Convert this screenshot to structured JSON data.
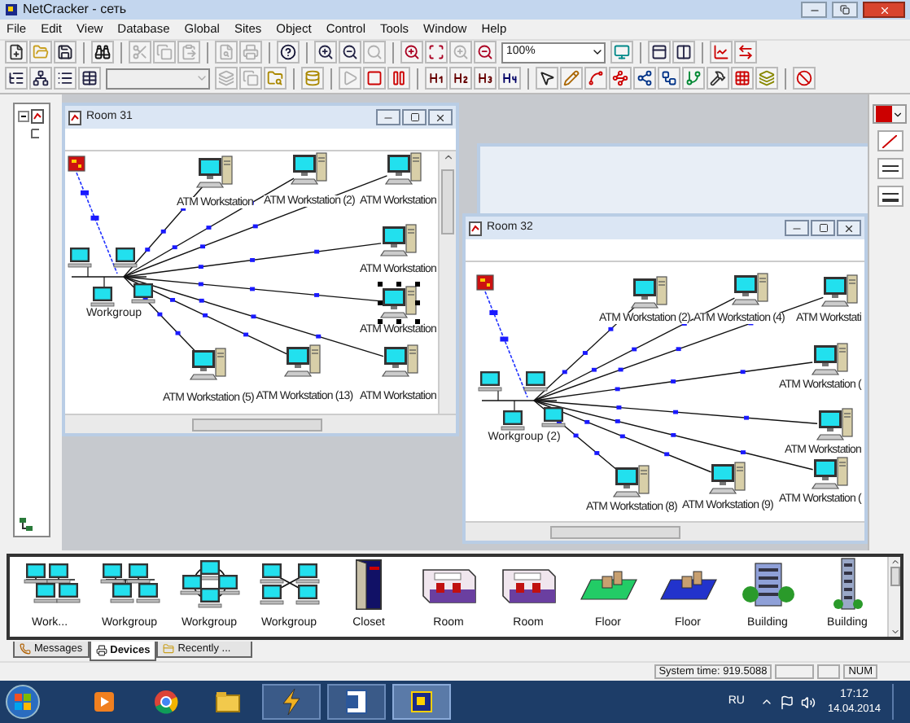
{
  "window": {
    "title": "NetCracker - сеть"
  },
  "menu": [
    "File",
    "Edit",
    "View",
    "Database",
    "Global",
    "Sites",
    "Object",
    "Control",
    "Tools",
    "Window",
    "Help"
  ],
  "toolbar_1": [
    {
      "kind": "button",
      "disabled": false
    },
    {
      "kind": "button",
      "disabled": false
    },
    {
      "kind": "button",
      "disabled": false
    },
    {
      "kind": "separator"
    },
    {
      "kind": "button",
      "disabled": false
    },
    {
      "kind": "separator"
    },
    {
      "kind": "button",
      "disabled": true
    },
    {
      "kind": "button",
      "disabled": true
    },
    {
      "kind": "button",
      "disabled": true
    },
    {
      "kind": "separator"
    },
    {
      "kind": "button",
      "disabled": true
    },
    {
      "kind": "button",
      "disabled": true
    },
    {
      "kind": "separator"
    },
    {
      "kind": "button",
      "disabled": false
    },
    {
      "kind": "separator"
    },
    {
      "kind": "button",
      "disabled": false
    },
    {
      "kind": "button",
      "disabled": false
    },
    {
      "kind": "button",
      "disabled": true
    },
    {
      "kind": "separator"
    },
    {
      "kind": "button",
      "disabled": false
    },
    {
      "kind": "button",
      "disabled": false
    },
    {
      "kind": "button",
      "disabled": true
    },
    {
      "kind": "button",
      "disabled": false
    },
    {
      "kind": "combo",
      "value": "100%",
      "disabled": false
    },
    {
      "kind": "button",
      "disabled": false
    },
    {
      "kind": "separator"
    },
    {
      "kind": "button",
      "disabled": false
    },
    {
      "kind": "button",
      "disabled": false
    },
    {
      "kind": "separator"
    },
    {
      "kind": "button",
      "disabled": false
    },
    {
      "kind": "button",
      "disabled": false
    }
  ],
  "toolbar_2": [
    {
      "kind": "button",
      "disabled": false
    },
    {
      "kind": "button",
      "disabled": false
    },
    {
      "kind": "button",
      "disabled": false
    },
    {
      "kind": "button",
      "disabled": false
    },
    {
      "kind": "combo",
      "disabled": true
    },
    {
      "kind": "button",
      "disabled": true
    },
    {
      "kind": "button",
      "disabled": true
    },
    {
      "kind": "button",
      "disabled": false
    },
    {
      "kind": "separator"
    },
    {
      "kind": "button",
      "disabled": false
    },
    {
      "kind": "separator"
    },
    {
      "kind": "button",
      "disabled": true
    },
    {
      "kind": "button",
      "disabled": false
    },
    {
      "kind": "button",
      "disabled": false
    },
    {
      "kind": "separator"
    },
    {
      "kind": "button",
      "disabled": false
    },
    {
      "kind": "button",
      "disabled": false
    },
    {
      "kind": "button",
      "disabled": false
    },
    {
      "kind": "button",
      "disabled": false
    },
    {
      "kind": "separator"
    },
    {
      "kind": "button",
      "disabled": false
    },
    {
      "kind": "button",
      "disabled": false
    },
    {
      "kind": "button",
      "disabled": false
    },
    {
      "kind": "button",
      "disabled": false
    },
    {
      "kind": "button",
      "disabled": false
    },
    {
      "kind": "button",
      "disabled": false
    },
    {
      "kind": "button",
      "disabled": false
    },
    {
      "kind": "button",
      "disabled": false
    },
    {
      "kind": "button",
      "disabled": false
    },
    {
      "kind": "button",
      "disabled": false
    },
    {
      "kind": "separator"
    },
    {
      "kind": "button",
      "disabled": false
    }
  ],
  "tree": {
    "expanded": true
  },
  "rooms": [
    {
      "title": "Room 31",
      "workgroup_label": "Workgroup",
      "nodes": [
        {
          "label": "ATM Workstation",
          "selected": false
        },
        {
          "label": "ATM Workstation (2)",
          "selected": false
        },
        {
          "label": "ATM Workstation",
          "selected": false
        },
        {
          "label": "ATM Workstation",
          "selected": false
        },
        {
          "label": "ATM Workstation",
          "selected": true
        },
        {
          "label": "ATM Workstation (5)",
          "selected": false
        },
        {
          "label": "ATM Workstation (13)",
          "selected": false
        },
        {
          "label": "ATM Workstation",
          "selected": false
        }
      ]
    },
    {
      "title": "Room 32",
      "workgroup_label": "Workgroup (2)",
      "nodes": [
        {
          "label": "ATM Workstation (2)",
          "selected": false
        },
        {
          "label": "ATM Workstation (4)",
          "selected": false
        },
        {
          "label": "ATM Workstati",
          "selected": false
        },
        {
          "label": "ATM Workstation (",
          "selected": false
        },
        {
          "label": "ATM Workstation",
          "selected": false
        },
        {
          "label": "ATM Workstation (",
          "selected": false
        },
        {
          "label": "ATM Workstation (8)",
          "selected": false
        },
        {
          "label": "ATM Workstation (9)",
          "selected": false
        }
      ]
    }
  ],
  "palette": [
    {
      "label": "Work...",
      "kind": "bus-workgroup"
    },
    {
      "label": "Workgroup",
      "kind": "tree-workgroup"
    },
    {
      "label": "Workgroup",
      "kind": "ring-workgroup"
    },
    {
      "label": "Workgroup",
      "kind": "star-workgroup"
    },
    {
      "label": "Closet",
      "kind": "closet"
    },
    {
      "label": "Room",
      "kind": "room"
    },
    {
      "label": "Room",
      "kind": "room"
    },
    {
      "label": "Floor",
      "kind": "floor",
      "color": "#22cc66"
    },
    {
      "label": "Floor",
      "kind": "floor",
      "color": "#2233cc"
    },
    {
      "label": "Building",
      "kind": "office-building"
    },
    {
      "label": "Building",
      "kind": "tower-building"
    }
  ],
  "tabs": [
    {
      "label": "Messages",
      "selected": false
    },
    {
      "label": "Devices",
      "selected": true
    },
    {
      "label": "Recently ...",
      "selected": false
    }
  ],
  "status_bar": {
    "system_time": "System time: 919.5088",
    "indicator": "NUM"
  },
  "taskbar": {
    "language": "RU",
    "time": "17:12",
    "date": "14.04.2014"
  }
}
